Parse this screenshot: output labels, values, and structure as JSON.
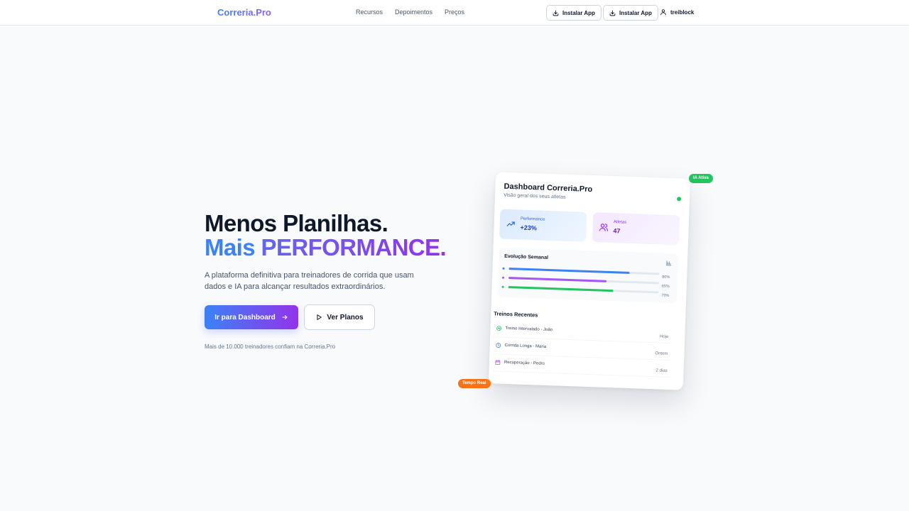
{
  "header": {
    "logo": "Correria.Pro",
    "nav": [
      "Recursos",
      "Depoimentos",
      "Preços"
    ],
    "install_buttons": [
      "Instalar App",
      "Instalar App"
    ],
    "username": "treiblock"
  },
  "hero": {
    "title_line1": "Menos Planilhas.",
    "title_mais": "Mais",
    "title_performance": "PERFORMANCE.",
    "subtitle": "A plataforma definitiva para treinadores de corrida que usam dados e IA para alcançar resultados extraordinários.",
    "primary_cta": "Ir para Dashboard",
    "secondary_cta": "Ver Planos",
    "trust_text": "Mais de 10.000 treinadores confiam na Correria.Pro"
  },
  "dashboard": {
    "title": "Dashboard Correria.Pro",
    "subtitle": "Visão geral dos seus atletas",
    "stats": [
      {
        "label": "Performance",
        "value": "+23%"
      },
      {
        "label": "Atletas",
        "value": "47"
      }
    ],
    "weekly": {
      "title": "Evolução Semanal",
      "bars": [
        {
          "percent": 80,
          "label": "80%",
          "color": "#3b82f6"
        },
        {
          "percent": 65,
          "label": "65%",
          "color": "#a855f7"
        },
        {
          "percent": 70,
          "label": "70%",
          "color": "#22c55e"
        }
      ]
    },
    "recent": {
      "title": "Treinos Recentes",
      "items": [
        {
          "name": "Treino Intervalado - João",
          "when": "Hoje",
          "icon": "activity-icon"
        },
        {
          "name": "Corrida Longa - Maria",
          "when": "Ontem",
          "icon": "clock-icon"
        },
        {
          "name": "Recuperação - Pedro",
          "when": "2 dias",
          "icon": "calendar-icon"
        }
      ]
    }
  },
  "badges": {
    "ia": "IA Ativa",
    "realtime": "Tempo Real"
  },
  "colors": {
    "brand_blue": "#3b82f6",
    "brand_purple": "#9333ea",
    "success": "#22c55e",
    "warning": "#f97316"
  }
}
